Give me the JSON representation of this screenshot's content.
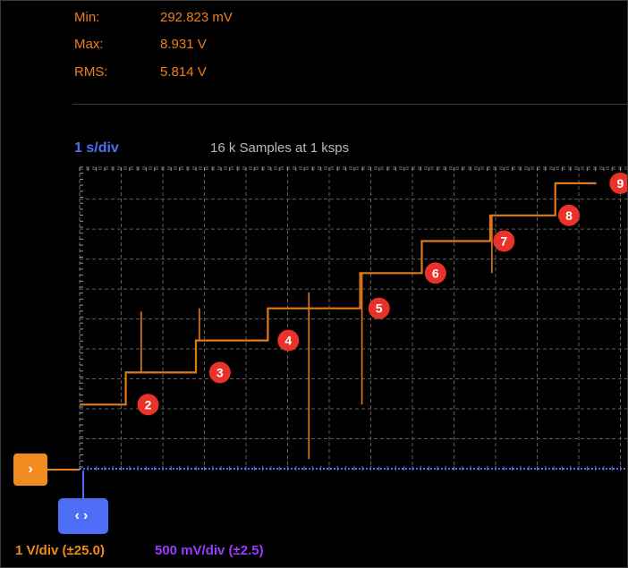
{
  "stats": {
    "min_label": "Min:",
    "min_value": "292.823 mV",
    "max_label": "Max:",
    "max_value": "8.931 V",
    "rms_label": "RMS:",
    "rms_value": "5.814 V"
  },
  "timebase": "1 s/div",
  "samples": "16 k Samples at 1 ksps",
  "channel_marker_icon": "chevron-right-icon",
  "horizontal_marker_icon": "chevron-left-right-icon",
  "range_a": "1 V/div (±25.0)",
  "range_b": "500 mV/div (±2.5)",
  "colors": {
    "trace": "#e07a1a",
    "timebase": "#4f6ef7",
    "range_b": "#9a3bff",
    "marker_badge": "#e8322a"
  },
  "chart_data": {
    "type": "line",
    "title": "",
    "xlabel": "",
    "ylabel": "",
    "xlim": [
      0,
      16
    ],
    "ylim": [
      0,
      9.4
    ],
    "grid": true,
    "series": [
      {
        "name": "",
        "x": [
          0.0,
          1.35,
          1.35,
          3.4,
          3.4,
          5.5,
          5.5,
          8.2,
          8.2,
          10.0,
          10.0,
          12.0,
          12.0,
          13.9,
          13.9,
          15.1
        ],
        "y": [
          2.0,
          2.0,
          3.0,
          3.0,
          4.0,
          4.0,
          5.0,
          5.0,
          6.1,
          6.1,
          7.1,
          7.1,
          7.9,
          7.9,
          8.9,
          8.9
        ]
      }
    ],
    "spikes": [
      {
        "x": 1.8,
        "from": 3.0,
        "to": 4.9
      },
      {
        "x": 3.5,
        "from": 4.0,
        "to": 5.0
      },
      {
        "x": 6.7,
        "from": 0.3,
        "to": 5.5
      },
      {
        "x": 8.25,
        "from": 2.0,
        "to": 6.1
      },
      {
        "x": 12.05,
        "from": 6.1,
        "to": 7.9
      }
    ],
    "markers": [
      {
        "label": "2",
        "x": 2.0,
        "y": 2.0
      },
      {
        "label": "3",
        "x": 4.1,
        "y": 3.0
      },
      {
        "label": "4",
        "x": 6.1,
        "y": 4.0
      },
      {
        "label": "5",
        "x": 8.75,
        "y": 5.0
      },
      {
        "label": "6",
        "x": 10.4,
        "y": 6.1
      },
      {
        "label": "7",
        "x": 12.4,
        "y": 7.1
      },
      {
        "label": "8",
        "x": 14.3,
        "y": 7.9
      },
      {
        "label": "9",
        "x": 15.8,
        "y": 8.9
      }
    ]
  }
}
